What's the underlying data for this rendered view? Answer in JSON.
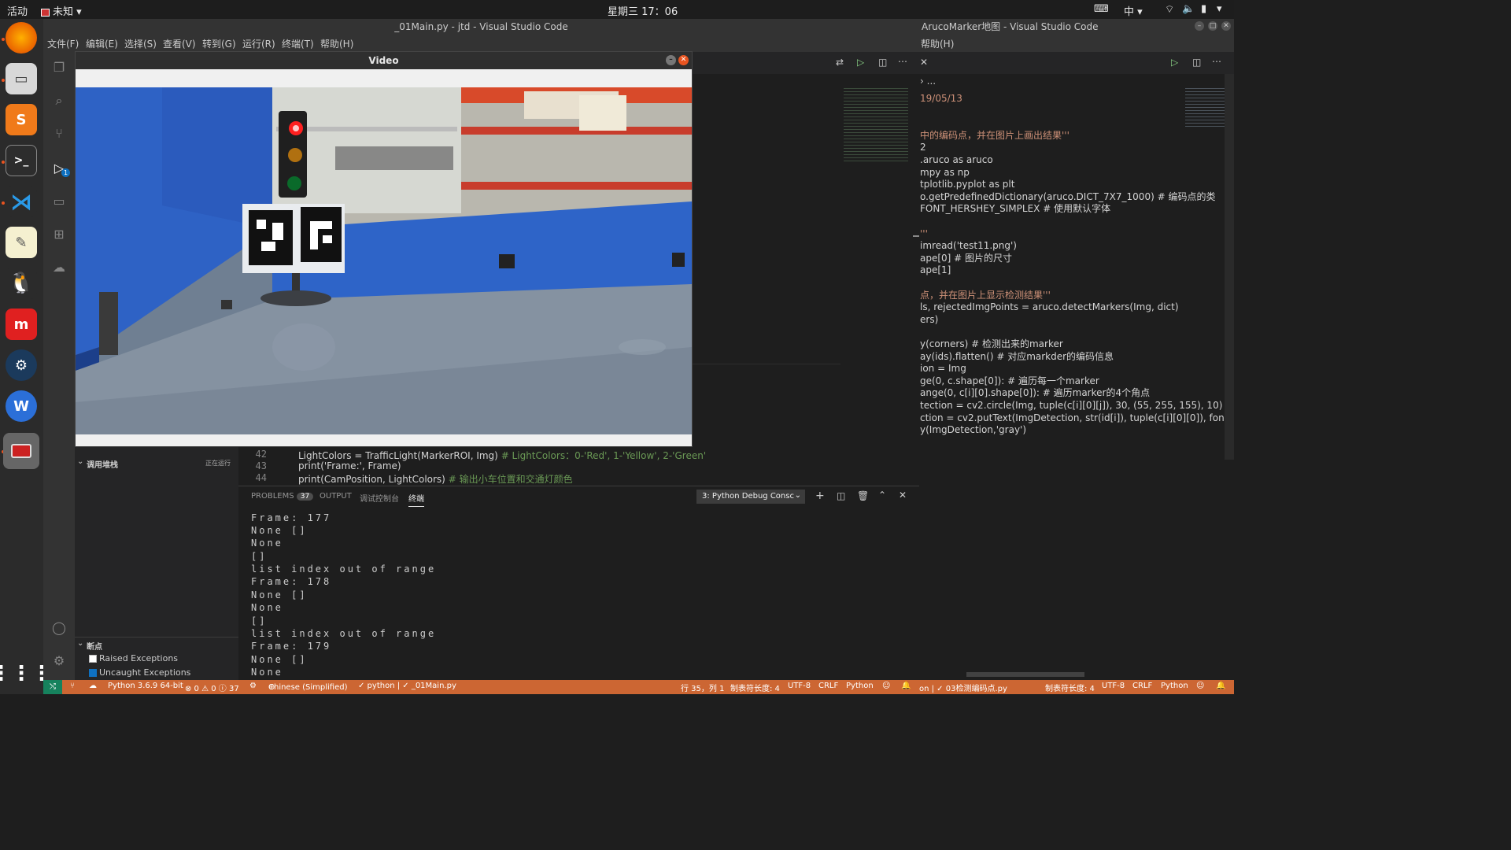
{
  "topbar": {
    "activities": "活动",
    "app_menu": "未知",
    "clock": "星期三 17：06",
    "input_method": "中"
  },
  "left_window": {
    "title": "_01Main.py - jtd - Visual Studio Code",
    "menu": [
      "文件(F)",
      "编辑(E)",
      "选择(S)",
      "查看(V)",
      "转到(G)",
      "运行(R)",
      "终端(T)",
      "帮助(H)"
    ],
    "debug_badge": "1"
  },
  "video_window": {
    "title": "Video"
  },
  "sidebar": {
    "call_stack_label": "调用堆栈",
    "call_stack_status": "正在运行",
    "breakpoints_label": "断点",
    "breakpoints": [
      {
        "label": "Raised Exceptions",
        "checked": false
      },
      {
        "label": "Uncaught Exceptions",
        "checked": true
      }
    ]
  },
  "code": {
    "lines": [
      {
        "num": "42",
        "text": "LightColors = TrafficLight(MarkerROI, Img)",
        "comment": "# LightColors：0-'Red', 1-'Yellow', 2-'Green'"
      },
      {
        "num": "43",
        "text": "print('Frame:', Frame)",
        "comment": ""
      },
      {
        "num": "44",
        "text": "print(CamPosition, LightColors)",
        "comment": "# 输出小车位置和交通灯颜色"
      }
    ]
  },
  "panel": {
    "tabs": [
      "PROBLEMS",
      "OUTPUT",
      "调试控制台",
      "终端"
    ],
    "problems_count": "37",
    "terminal_select": "3: Python Debug Consc"
  },
  "terminal_lines": [
    "Frame: 177",
    "None []",
    "None",
    "[]",
    "list index out of range",
    "Frame: 178",
    "None []",
    "None",
    "[]",
    "list index out of range",
    "Frame: 179",
    "None []",
    "None"
  ],
  "right_window": {
    "title": "ArucoMarker地图 - Visual Studio Code",
    "menu_help": "帮助(H)",
    "breadcrumb": "...",
    "lines": [
      {
        "text": "19/05/13",
        "color": "#ce9178"
      },
      {
        "text": "",
        "color": "#d4d4d4"
      },
      {
        "text": "",
        "color": "#d4d4d4"
      },
      {
        "text": "中的编码点，并在图片上画出结果'''",
        "color": "#ce9178"
      },
      {
        "text": "2",
        "color": "#d4d4d4"
      },
      {
        "text": ".aruco as aruco",
        "color": "#d4d4d4"
      },
      {
        "text": "mpy as np",
        "color": "#d4d4d4"
      },
      {
        "text": "tplotlib.pyplot as plt",
        "color": "#d4d4d4"
      },
      {
        "text": "o.getPredefinedDictionary(aruco.DICT_7X7_1000) # 编码点的类",
        "color": "#d4d4d4"
      },
      {
        "text": "FONT_HERSHEY_SIMPLEX # 使用默认字体",
        "color": "#d4d4d4"
      },
      {
        "text": "",
        "color": "#d4d4d4"
      },
      {
        "text": "'''",
        "color": "#ce9178"
      },
      {
        "text": "imread('test11.png')",
        "color": "#d4d4d4"
      },
      {
        "text": "ape[0] # 图片的尺寸",
        "color": "#d4d4d4"
      },
      {
        "text": "ape[1]",
        "color": "#d4d4d4"
      },
      {
        "text": "",
        "color": "#d4d4d4"
      },
      {
        "text": "点，并在图片上显示检测结果'''",
        "color": "#ce9178"
      },
      {
        "text": "ls, rejectedImgPoints = aruco.detectMarkers(Img, dict)",
        "color": "#d4d4d4"
      },
      {
        "text": "ers)",
        "color": "#d4d4d4"
      },
      {
        "text": "",
        "color": "#d4d4d4"
      },
      {
        "text": "y(corners) # 检测出来的marker",
        "color": "#d4d4d4"
      },
      {
        "text": "ay(ids).flatten() # 对应markder的编码信息",
        "color": "#d4d4d4"
      },
      {
        "text": "ion = Img",
        "color": "#d4d4d4"
      },
      {
        "text": "ge(0, c.shape[0]): # 遍历每一个marker",
        "color": "#d4d4d4"
      },
      {
        "text": "ange(0, c[i][0].shape[0]): # 遍历marker的4个角点",
        "color": "#d4d4d4"
      },
      {
        "text": "tection = cv2.circle(Img, tuple(c[i][0][j]), 30, (55, 255, 155), 10) #",
        "color": "#d4d4d4"
      },
      {
        "text": "ction = cv2.putText(ImgDetection, str(id[i]), tuple(c[i][0][0]), fon",
        "color": "#d4d4d4"
      },
      {
        "text": "y(ImgDetection,'gray')",
        "color": "#d4d4d4"
      }
    ]
  },
  "statusbar": {
    "python": "Python 3.6.9 64-bit",
    "problems": "⊗ 0 ⚠ 0 ⓘ 37",
    "language_pack": "Chinese (Simplified)",
    "tasks": "✓ python | ✓ _01Main.py",
    "cursor": "行 35，列 1",
    "tab_size": "制表符长度: 4",
    "encoding": "UTF-8",
    "eol": "CRLF",
    "language": "Python",
    "right_file": "on | ✓ 03检测编码点.py",
    "right_tab_size": "制表符长度: 4",
    "right_encoding": "UTF-8",
    "right_eol": "CRLF",
    "right_language": "Python"
  },
  "colors": {
    "statusbar": "#cc6633",
    "dock": "#2b2b2b",
    "vscode_bg": "#1e1e1e",
    "accent": "#0e70c0"
  }
}
